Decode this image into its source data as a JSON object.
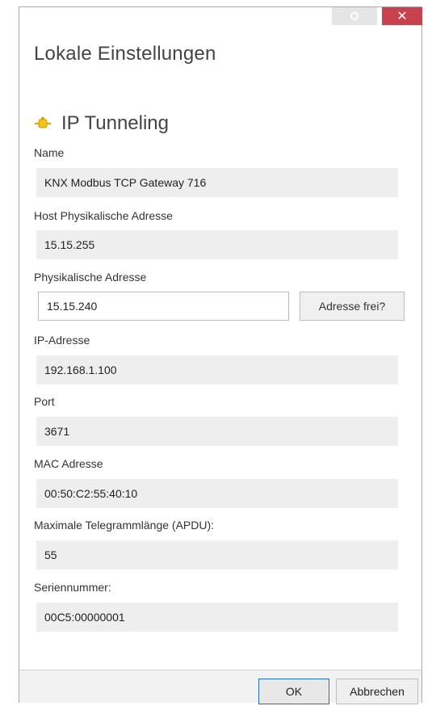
{
  "window": {
    "title": "Lokale Einstellungen",
    "close_glyph": "✕"
  },
  "section": {
    "title": "IP Tunneling",
    "icon": "plug-connector-icon",
    "icon_color": "#f0c419"
  },
  "fields": {
    "name": {
      "label": "Name",
      "value": "KNX Modbus TCP Gateway 716"
    },
    "host_physical_address": {
      "label": "Host Physikalische Adresse",
      "value": "15.15.255"
    },
    "physical_address": {
      "label": "Physikalische Adresse",
      "value": "15.15.240",
      "check_button": "Adresse frei?"
    },
    "ip_address": {
      "label": "IP-Adresse",
      "value": "192.168.1.100"
    },
    "port": {
      "label": "Port",
      "value": "3671"
    },
    "mac_address": {
      "label": "MAC Adresse",
      "value": "00:50:C2:55:40:10"
    },
    "max_apdu": {
      "label": "Maximale Telegrammlänge (APDU):",
      "value": "55"
    },
    "serial": {
      "label": "Seriennummer:",
      "value": "00C5:00000001"
    }
  },
  "footer": {
    "ok_label": "OK",
    "cancel_label": "Abbrechen"
  },
  "colors": {
    "close_button": "#c7424e",
    "ok_border": "#1e6ec8"
  }
}
